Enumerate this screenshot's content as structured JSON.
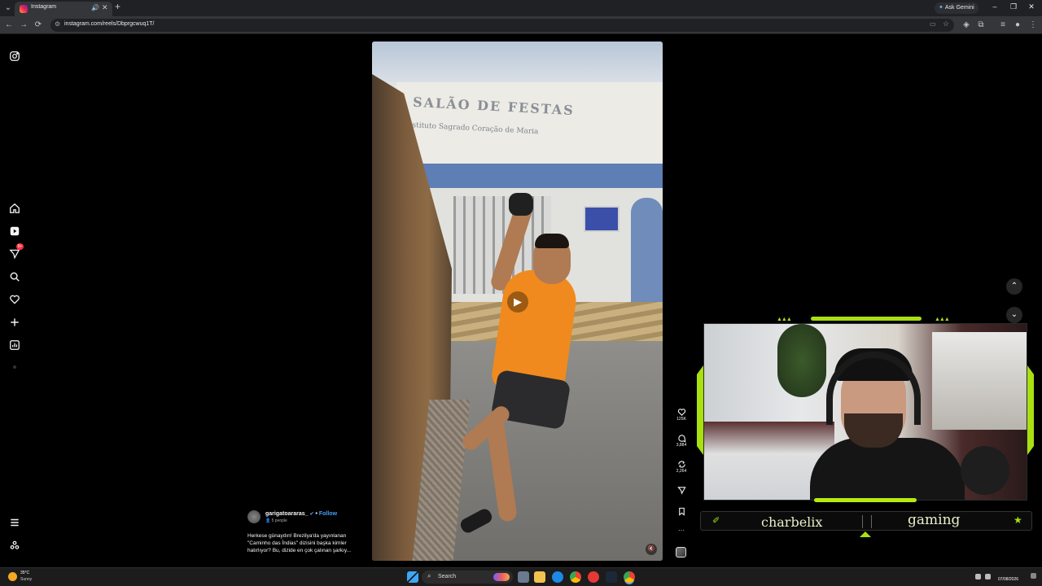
{
  "browser": {
    "tab_title": "Instagram",
    "new_tab_label": "+",
    "ask_gemini_label": "Ask Gemini",
    "url": "instagram.com/reels/Dbprgcwuq1T/",
    "nav_back_glyph": "←",
    "nav_forward_glyph": "→",
    "nav_reload_glyph": "⟳"
  },
  "nav": {
    "notification_badge": "9+"
  },
  "reel": {
    "sign_title": "SALÃO DE FESTAS",
    "sign_subtitle": "Instituto Sagrado Coração de Maria",
    "username": "garigatoararas_",
    "verified_glyph": "✔",
    "separator": " • ",
    "follow_label": "Follow",
    "followers_note": "👤 5 people",
    "caption": "Herkese günaydın! Brezilya'da yayınlanan \"Caminho das Índias\" dizisini başka kimler hatırlıyor? Bu, dizide en çok çalınan şarkıy...",
    "play_glyph": "▶",
    "mute_glyph": "🔇"
  },
  "actions": {
    "likes": "125K",
    "comments": "3,884",
    "reposts": "2,264",
    "more_glyph": "···"
  },
  "overlay": {
    "name_left": "charbelix",
    "name_right": "gaming",
    "left_icon_glyph": "✐",
    "right_icon_glyph": "★"
  },
  "taskbar": {
    "weather_temp": "35°C",
    "weather_condition": "Sunny",
    "search_label": "Search",
    "date": "07/08/2026"
  },
  "colors": {
    "accent_green": "#a8e010",
    "instagram_blue": "#4a9ff5",
    "badge_red": "#ff3040",
    "shirt_orange": "#f08a1e"
  }
}
